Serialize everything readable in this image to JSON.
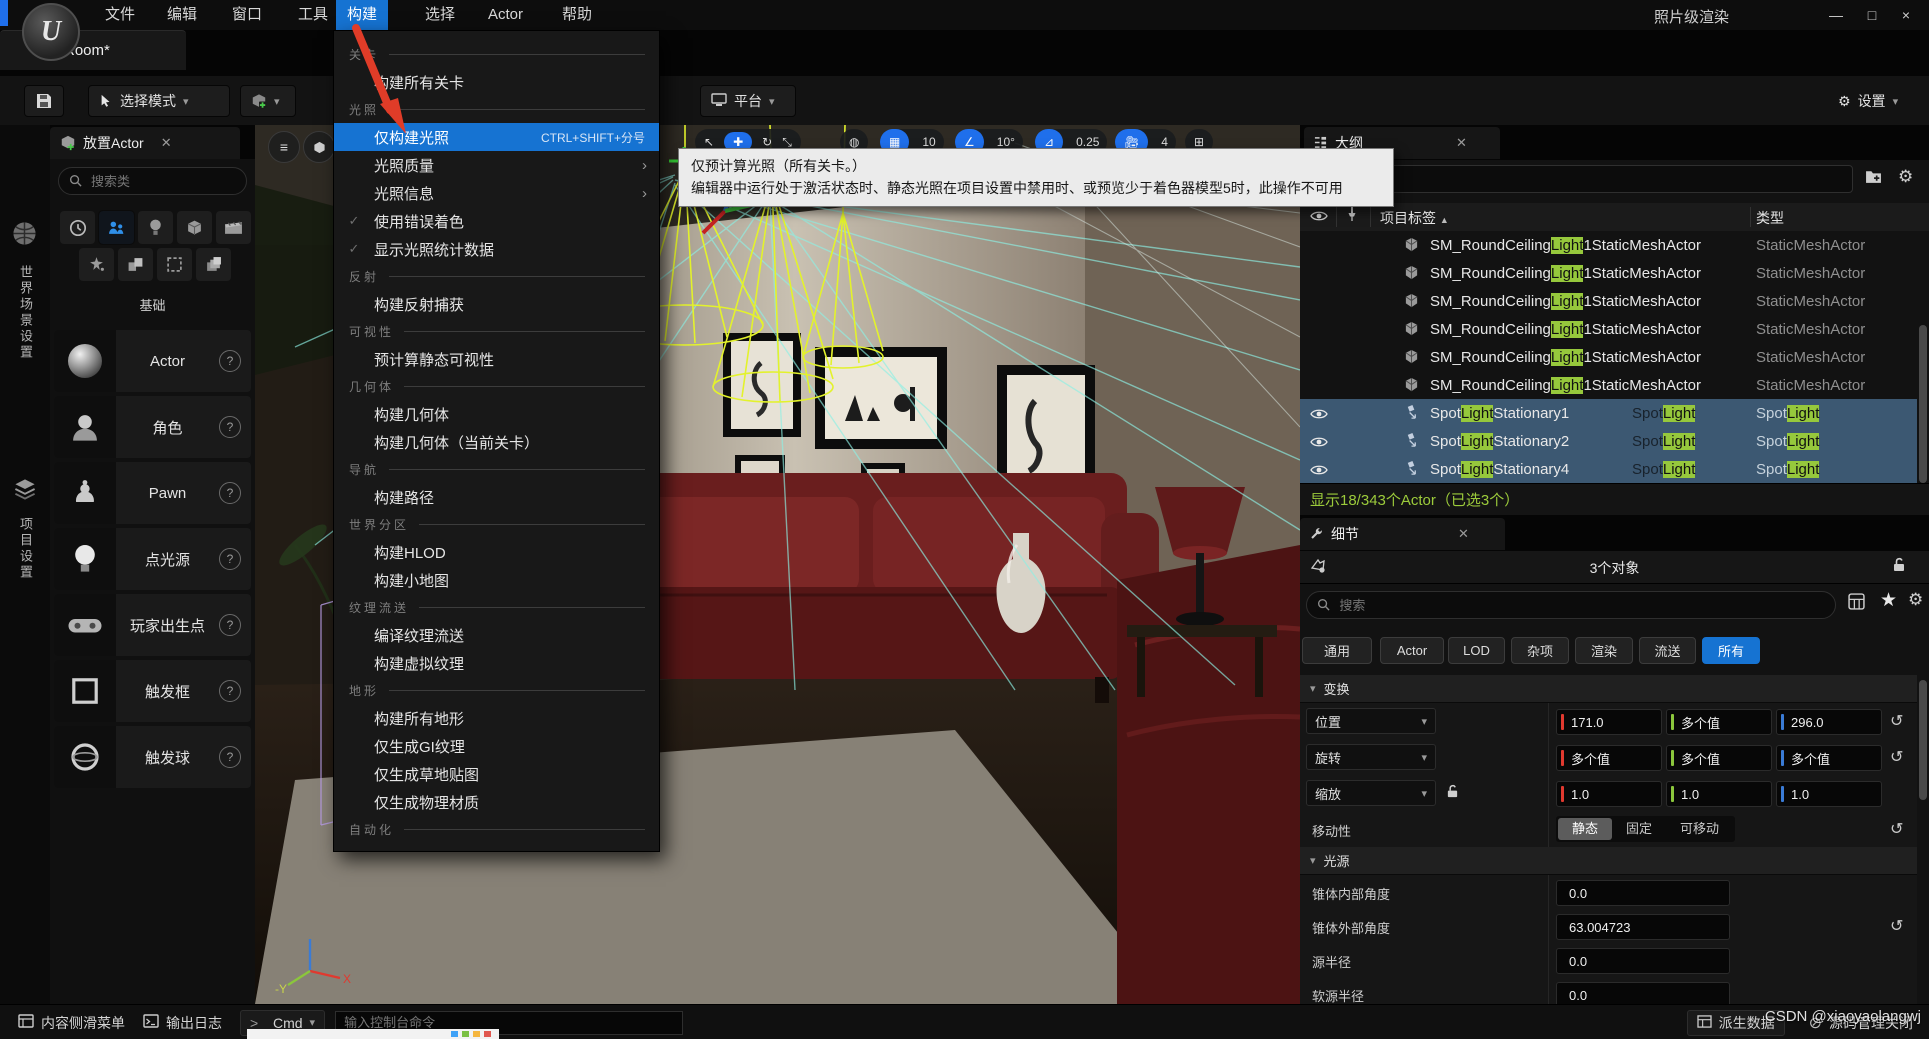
{
  "titlebar": {
    "menus": [
      "文件",
      "编辑",
      "窗口",
      "工具",
      "构建",
      "选择",
      "Actor",
      "帮助"
    ],
    "active_menu": "构建",
    "right_text": "照片级渲染",
    "tab": "Room*"
  },
  "toolbar": {
    "select_mode": "选择模式",
    "platform": "平台",
    "settings": "设置"
  },
  "build_menu": {
    "sections": [
      {
        "label": "关卡",
        "items": [
          {
            "label": "构建所有关卡"
          }
        ]
      },
      {
        "label": "光照",
        "items": [
          {
            "label": "仅构建光照",
            "shortcut": "CTRL+SHIFT+分号",
            "highlighted": true
          },
          {
            "label": "光照质量",
            "submenu": true
          },
          {
            "label": "光照信息",
            "submenu": true
          },
          {
            "label": "使用错误着色",
            "check": true
          },
          {
            "label": "显示光照统计数据",
            "check": true
          }
        ]
      },
      {
        "label": "反射",
        "items": [
          {
            "label": "构建反射捕获"
          }
        ]
      },
      {
        "label": "可视性",
        "items": [
          {
            "label": "预计算静态可视性"
          }
        ]
      },
      {
        "label": "几何体",
        "items": [
          {
            "label": "构建几何体"
          },
          {
            "label": "构建几何体（当前关卡）"
          }
        ]
      },
      {
        "label": "导航",
        "items": [
          {
            "label": "构建路径"
          }
        ]
      },
      {
        "label": "世界分区",
        "items": [
          {
            "label": "构建HLOD"
          },
          {
            "label": "构建小地图"
          }
        ]
      },
      {
        "label": "纹理流送",
        "items": [
          {
            "label": "编译纹理流送"
          },
          {
            "label": "构建虚拟纹理"
          }
        ]
      },
      {
        "label": "地形",
        "items": [
          {
            "label": "构建所有地形"
          },
          {
            "label": "仅生成GI纹理"
          },
          {
            "label": "仅生成草地贴图"
          },
          {
            "label": "仅生成物理材质"
          }
        ]
      },
      {
        "label": "自动化",
        "items": []
      }
    ]
  },
  "tooltip": {
    "line1": "仅预计算光照（所有关卡。）",
    "line2": "编辑器中运行处于激活状态时、静态光照在项目设置中禁用时、或预览少于着色器模型5时，此操作不可用"
  },
  "viewport_toolbar": {
    "grid_snap": "10",
    "rotation_snap": "10°",
    "scale_snap": "0.25",
    "camera_speed": "4"
  },
  "left_strip": {
    "items": [
      {
        "label": "世界场景设置"
      },
      {
        "label": "项目设置"
      }
    ]
  },
  "place_actors": {
    "tab": "放置Actor",
    "search_placeholder": "搜索类",
    "group": "基础",
    "items": [
      {
        "label": "Actor",
        "icon": "actor-sphere"
      },
      {
        "label": "角色",
        "icon": "character"
      },
      {
        "label": "Pawn",
        "icon": "pawn"
      },
      {
        "label": "点光源",
        "icon": "point-light"
      },
      {
        "label": "玩家出生点",
        "icon": "player-start"
      },
      {
        "label": "触发框",
        "icon": "trigger-box"
      },
      {
        "label": "触发球",
        "icon": "trigger-sphere"
      }
    ]
  },
  "outliner": {
    "tab": "大纲",
    "columns": {
      "label": "项目标签",
      "type": "类型"
    },
    "rows": [
      {
        "selected": false,
        "icon": "static-mesh",
        "label": [
          {
            "t": "SM_RoundCeiling"
          },
          {
            "t": "Light",
            "h": true
          },
          {
            "t": "1StaticMeshActor"
          }
        ],
        "mid": [],
        "type": [
          {
            "t": "StaticMeshActor"
          }
        ]
      },
      {
        "selected": false,
        "icon": "static-mesh",
        "label": [
          {
            "t": "SM_RoundCeiling"
          },
          {
            "t": "Light",
            "h": true
          },
          {
            "t": "1StaticMeshActor"
          }
        ],
        "mid": [],
        "type": [
          {
            "t": "StaticMeshActor"
          }
        ]
      },
      {
        "selected": false,
        "icon": "static-mesh",
        "label": [
          {
            "t": "SM_RoundCeiling"
          },
          {
            "t": "Light",
            "h": true
          },
          {
            "t": "1StaticMeshActor"
          }
        ],
        "mid": [],
        "type": [
          {
            "t": "StaticMeshActor"
          }
        ]
      },
      {
        "selected": false,
        "icon": "static-mesh",
        "label": [
          {
            "t": "SM_RoundCeiling"
          },
          {
            "t": "Light",
            "h": true
          },
          {
            "t": "1StaticMeshActor"
          }
        ],
        "mid": [],
        "type": [
          {
            "t": "StaticMeshActor"
          }
        ]
      },
      {
        "selected": false,
        "icon": "static-mesh",
        "label": [
          {
            "t": "SM_RoundCeiling"
          },
          {
            "t": "Light",
            "h": true
          },
          {
            "t": "1StaticMeshActor"
          }
        ],
        "mid": [],
        "type": [
          {
            "t": "StaticMeshActor"
          }
        ]
      },
      {
        "selected": false,
        "icon": "static-mesh",
        "label": [
          {
            "t": "SM_RoundCeiling"
          },
          {
            "t": "Light",
            "h": true
          },
          {
            "t": "1StaticMeshActor"
          }
        ],
        "mid": [],
        "type": [
          {
            "t": "StaticMeshActor"
          }
        ]
      },
      {
        "selected": true,
        "icon": "spot-light",
        "label": [
          {
            "t": "Spot"
          },
          {
            "t": "Light",
            "h": true
          },
          {
            "t": "Stationary1"
          }
        ],
        "mid": [
          {
            "t": "Spot"
          },
          {
            "t": "Light",
            "h": true
          }
        ],
        "type": [
          {
            "t": "Spot"
          },
          {
            "t": "Light",
            "h": true
          }
        ]
      },
      {
        "selected": true,
        "icon": "spot-light",
        "label": [
          {
            "t": "Spot"
          },
          {
            "t": "Light",
            "h": true
          },
          {
            "t": "Stationary2"
          }
        ],
        "mid": [
          {
            "t": "Spot"
          },
          {
            "t": "Light",
            "h": true
          }
        ],
        "type": [
          {
            "t": "Spot"
          },
          {
            "t": "Light",
            "h": true
          }
        ]
      },
      {
        "selected": true,
        "icon": "spot-light",
        "label": [
          {
            "t": "Spot"
          },
          {
            "t": "Light",
            "h": true
          },
          {
            "t": "Stationary4"
          }
        ],
        "mid": [
          {
            "t": "Spot"
          },
          {
            "t": "Light",
            "h": true
          }
        ],
        "type": [
          {
            "t": "Spot"
          },
          {
            "t": "Light",
            "h": true
          }
        ]
      }
    ],
    "status": "显示18/343个Actor（已选3个）"
  },
  "details": {
    "tab": "细节",
    "objects": "3个对象",
    "search_placeholder": "搜索",
    "filters": [
      "通用",
      "Actor",
      "LOD",
      "杂项",
      "渲染",
      "流送",
      "所有"
    ],
    "active_filter": "所有",
    "sections": {
      "transform": "变换",
      "light": "光源"
    },
    "transform_rows": [
      {
        "label": "位置",
        "x": "171.0",
        "y": "多个值",
        "z": "296.0",
        "reset": true
      },
      {
        "label": "旋转",
        "x": "多个值",
        "y": "多个值",
        "z": "多个值",
        "reset": true
      },
      {
        "label": "缩放",
        "x": "1.0",
        "y": "1.0",
        "z": "1.0",
        "lock": true
      }
    ],
    "mobility": {
      "label": "移动性",
      "options": [
        "静态",
        "固定",
        "可移动"
      ],
      "selected": "静态",
      "reset": true
    },
    "light_rows": [
      {
        "label": "锥体内部角度",
        "value": "0.0"
      },
      {
        "label": "锥体外部角度",
        "value": "63.004723",
        "reset": true
      },
      {
        "label": "源半径",
        "value": "0.0"
      },
      {
        "label": "软源半径",
        "value": "0.0"
      }
    ]
  },
  "bottom_bar": {
    "content_drawer": "内容侧滑菜单",
    "output_log": "输出日志",
    "cmd": "Cmd",
    "console_placeholder": "输入控制台命令",
    "derived_data": "派生数据",
    "source_control": "源码管理关闭"
  },
  "watermark": "CSDN @xiaoyaolangwj",
  "colors": {
    "accent": "#1673d2",
    "highlight_green": "#96c83c",
    "status_green": "#9ccb3b",
    "axis_x": "#e0392f",
    "axis_y": "#8bc63c",
    "axis_z": "#3a7bd5"
  }
}
